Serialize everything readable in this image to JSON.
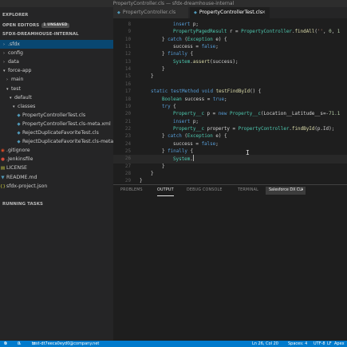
{
  "window": {
    "title": "PropertyController.cls — sfdx-dreamhouse-internal"
  },
  "tabs": [
    {
      "label": "PropertyController.cls",
      "icon": "apex-file-icon"
    },
    {
      "label": "PropertyControllerTest.cls",
      "icon": "apex-file-icon",
      "close": "×"
    }
  ],
  "sidebar": {
    "explorer_title": "EXPLORER",
    "open_editors": {
      "label": "OPEN EDITORS",
      "badge": "1 UNSAVED"
    },
    "project": {
      "label": "SFDX-DREAMHOUSE-INTERNAL"
    },
    "tree": [
      {
        "label": ".sfdx",
        "kind": "folder",
        "expanded": false
      },
      {
        "label": "config",
        "kind": "folder",
        "expanded": false
      },
      {
        "label": "data",
        "kind": "folder",
        "expanded": false
      },
      {
        "label": "force-app",
        "kind": "folder",
        "expanded": true
      },
      {
        "label": "main",
        "kind": "folder",
        "expanded": false
      },
      {
        "label": "test",
        "kind": "folder",
        "expanded": true
      },
      {
        "label": "default",
        "kind": "folder",
        "expanded": true
      },
      {
        "label": "classes",
        "kind": "folder",
        "expanded": true
      },
      {
        "label": "PropertyControllerTest.cls",
        "kind": "apex"
      },
      {
        "label": "PropertyControllerTest.cls-meta.xml",
        "kind": "xml"
      },
      {
        "label": "RejectDuplicateFavoriteTest.cls",
        "kind": "apex"
      },
      {
        "label": "RejectDuplicateFavoriteTest.cls-meta.xml",
        "kind": "xml"
      },
      {
        "label": ".gitignore",
        "kind": "git"
      },
      {
        "label": ".Jenkinsfile",
        "kind": "jenkins"
      },
      {
        "label": "LICENSE",
        "kind": "license"
      },
      {
        "label": "README.md",
        "kind": "markdown"
      },
      {
        "label": "sfdx-project.json",
        "kind": "json"
      }
    ],
    "running_tasks": "RUNNING TASKS"
  },
  "editor": {
    "lines": [
      {
        "n": "8",
        "text": "insert p;"
      },
      {
        "n": "9",
        "text": "PropertyPagedResult r = PropertyController.findAll('', 0, 1"
      },
      {
        "n": "10",
        "text": "} catch (Exception e) {"
      },
      {
        "n": "11",
        "text": "success = false;"
      },
      {
        "n": "12",
        "text": "} finally {"
      },
      {
        "n": "13",
        "text": "System.assert(success);"
      },
      {
        "n": "14",
        "text": "}"
      },
      {
        "n": "15",
        "text": "}"
      },
      {
        "n": "16",
        "text": ""
      },
      {
        "n": "17",
        "text": "static testMethod void testFindById() {"
      },
      {
        "n": "18",
        "text": "Boolean success = true;"
      },
      {
        "n": "19",
        "text": "try {"
      },
      {
        "n": "20",
        "text": "Property__c p = new Property__c(Location__Latitude__s=-71.1"
      },
      {
        "n": "21",
        "text": "insert p;"
      },
      {
        "n": "22",
        "text": "Property__c property = PropertyController.findById(p.Id);"
      },
      {
        "n": "23",
        "text": "} catch (Exception e) {"
      },
      {
        "n": "24",
        "text": "success = false;"
      },
      {
        "n": "25",
        "text": "} finally {"
      },
      {
        "n": "26",
        "text": "System."
      },
      {
        "n": "27",
        "text": "}"
      },
      {
        "n": "28",
        "text": "}"
      },
      {
        "n": "29",
        "text": "}"
      }
    ]
  },
  "panel": {
    "tabs": [
      "PROBLEMS",
      "OUTPUT",
      "DEBUG CONSOLE",
      "TERMINAL"
    ],
    "active_tab": "OUTPUT",
    "channel": "Salesforce DX CLI"
  },
  "statusbar": {
    "errors": "0",
    "warnings": "0",
    "org": "test-dt7eeca0eyd0@company.net",
    "position": "Ln 26, Col 20",
    "spaces": "Spaces: 4",
    "encoding": "UTF-8",
    "eol": "LF",
    "language": "Apex"
  },
  "colors": {
    "accent": "#007acc",
    "keyword": "#569cd6",
    "type": "#4ec9b0",
    "function": "#dcdcaa",
    "string": "#ce9178",
    "variable": "#9cdcfe"
  }
}
